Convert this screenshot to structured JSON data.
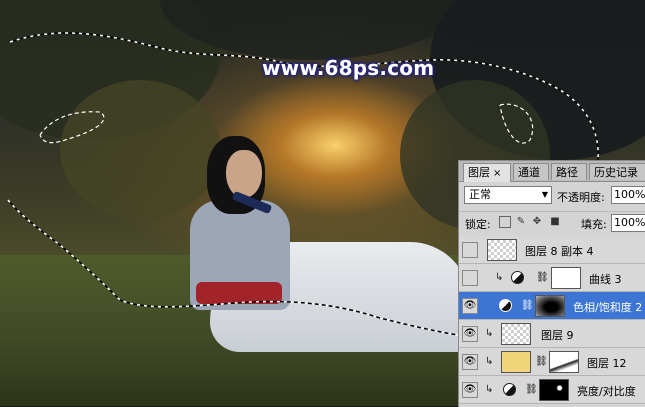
{
  "watermark": "www.68ps.com",
  "panel": {
    "tabs": [
      {
        "label": "图层",
        "close": "×",
        "active": true
      },
      {
        "label": "通道",
        "active": false
      },
      {
        "label": "路径",
        "active": false
      },
      {
        "label": "历史记录",
        "active": false
      }
    ],
    "blend_mode": "正常",
    "opacity_label": "不透明度:",
    "opacity_value": "100%",
    "lock_label": "锁定:",
    "fill_label": "填充:",
    "fill_value": "100%",
    "layers": [
      {
        "name": "图层 8 副本 4",
        "visible": false,
        "clipped": false,
        "adjustment": false,
        "thumb": "checker"
      },
      {
        "name": "曲线 3",
        "visible": false,
        "clipped": true,
        "adjustment": true,
        "thumb": "white-mask"
      },
      {
        "name": "色相/饱和度 2",
        "visible": true,
        "clipped": false,
        "adjustment": true,
        "thumb": "dark-mask",
        "selected": true
      },
      {
        "name": "图层 9",
        "visible": true,
        "clipped": true,
        "adjustment": false,
        "thumb": "checker"
      },
      {
        "name": "图层 12",
        "visible": true,
        "clipped": true,
        "adjustment": false,
        "thumb": "yellow"
      },
      {
        "name": "亮度/对比度",
        "visible": true,
        "clipped": true,
        "adjustment": true,
        "thumb": "black-mask"
      }
    ]
  },
  "colors": {
    "selected_row": "#3c75d4",
    "panel_bg": "#d4d4d4",
    "watermark_glow": "#2a2a8a"
  }
}
